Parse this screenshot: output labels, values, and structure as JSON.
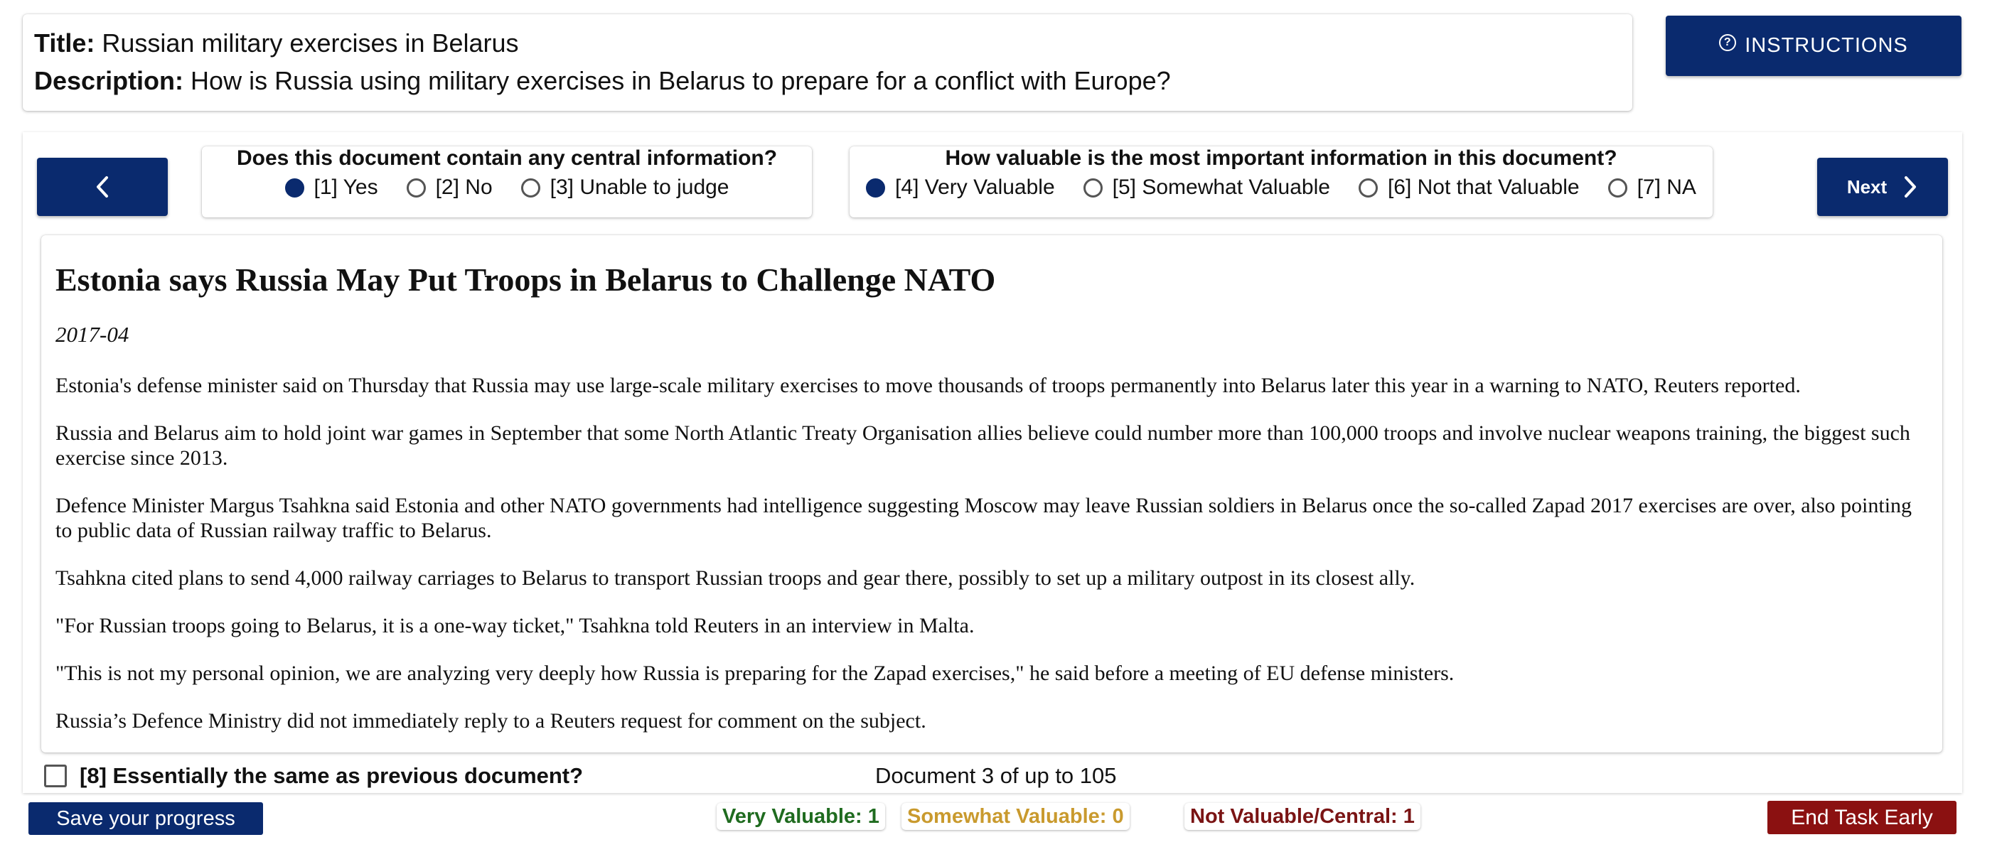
{
  "topic": {
    "title_label": "Title:",
    "title_value": "Russian military exercises in Belarus",
    "description_label": "Description:",
    "description_value": "How is Russia using military exercises in Belarus to prepare for a conflict with Europe?"
  },
  "header": {
    "instructions_icon": "?",
    "instructions_label": "INSTRUCTIONS"
  },
  "nav": {
    "prev_icon": "chevron-left-icon",
    "next_label": "Next",
    "next_icon": "chevron-right-icon"
  },
  "question1": {
    "label": "Does this document contain any central information?",
    "selected": "[1] Yes",
    "options": [
      "[1] Yes",
      "[2] No",
      "[3] Unable to judge"
    ]
  },
  "question2": {
    "label": "How valuable is the most important information in this document?",
    "selected": "[4] Very Valuable",
    "options": [
      "[4] Very Valuable",
      "[5] Somewhat Valuable",
      "[6] Not that Valuable",
      "[7] NA"
    ]
  },
  "article": {
    "title": "Estonia says Russia May Put Troops in Belarus to Challenge NATO",
    "date": "2017-04",
    "paragraphs": [
      "Estonia's defense minister said on Thursday that Russia may use large-scale military exercises to move thousands of troops permanently into Belarus later this year in a warning to NATO, Reuters reported.",
      "Russia and Belarus aim to hold joint war games in September that some North Atlantic Treaty Organisation allies believe could number more than 100,000 troops and involve nuclear weapons training, the biggest such exercise since 2013.",
      "Defence Minister Margus Tsahkna said Estonia and other NATO governments had intelligence suggesting Moscow may leave Russian soldiers in Belarus once the so-called Zapad 2017 exercises are over, also pointing to public data of Russian railway traffic to Belarus.",
      "Tsahkna cited plans to send 4,000 railway carriages to Belarus to transport Russian troops and gear there, possibly to set up a military outpost in its closest ally.",
      "\"For Russian troops going to Belarus, it is a one-way ticket,\" Tsahkna told Reuters in an interview in Malta.",
      "\"This is not my personal opinion, we are analyzing very deeply how Russia is preparing for the Zapad exercises,\" he said before a meeting of EU defense ministers.",
      "Russia’s Defence Ministry did not immediately reply to a Reuters request for comment on the subject."
    ]
  },
  "footer": {
    "same_doc_label": "[8] Essentially the same as previous document?",
    "same_doc_checked": false,
    "doc_counter": "Document 3 of up to 105",
    "save_label": "Save your progress",
    "tally_very": "Very Valuable: 1",
    "tally_somewhat": "Somewhat Valuable: 0",
    "tally_not": "Not Valuable/Central: 1",
    "end_label": "End Task Early"
  },
  "colors": {
    "navy": "#0a2a6e",
    "very_valuable": "#1f6b1f",
    "somewhat_valuable": "#c99a2e",
    "not_valuable": "#7a1414",
    "end_button": "#8b1111"
  }
}
